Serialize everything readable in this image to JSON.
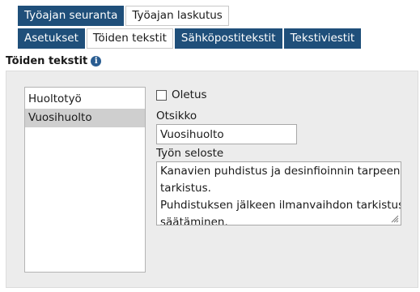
{
  "tabs_primary": [
    {
      "label": "Työajan seuranta",
      "active": true
    },
    {
      "label": "Työajan laskutus",
      "active": false
    }
  ],
  "tabs_secondary": [
    {
      "label": "Asetukset",
      "active": false
    },
    {
      "label": "Töiden tekstit",
      "active": true
    },
    {
      "label": "Sähköpostitekstit",
      "active": false
    },
    {
      "label": "Tekstiviestit",
      "active": false
    }
  ],
  "section": {
    "title": "Töiden tekstit",
    "info_icon": "info-icon"
  },
  "list": {
    "items": [
      "Huoltotyö",
      "Vuosihuolto"
    ],
    "selected": "Vuosihuolto"
  },
  "form": {
    "default_checkbox_label": "Oletus",
    "default_checked": false,
    "title_label": "Otsikko",
    "title_value": "Vuosihuolto",
    "description_label": "Työn seloste",
    "description_lines": [
      "Kanavien puhdistus ja desinfioinnin tarpeen",
      "tarkistus.",
      "Puhdistuksen jälkeen ilmanvaihdon tarkistus ja",
      "säätäminen."
    ]
  },
  "colors": {
    "tab_dark": "#1f4f7a",
    "panel_bg": "#ececec",
    "selected_item": "#cfcfcf"
  }
}
